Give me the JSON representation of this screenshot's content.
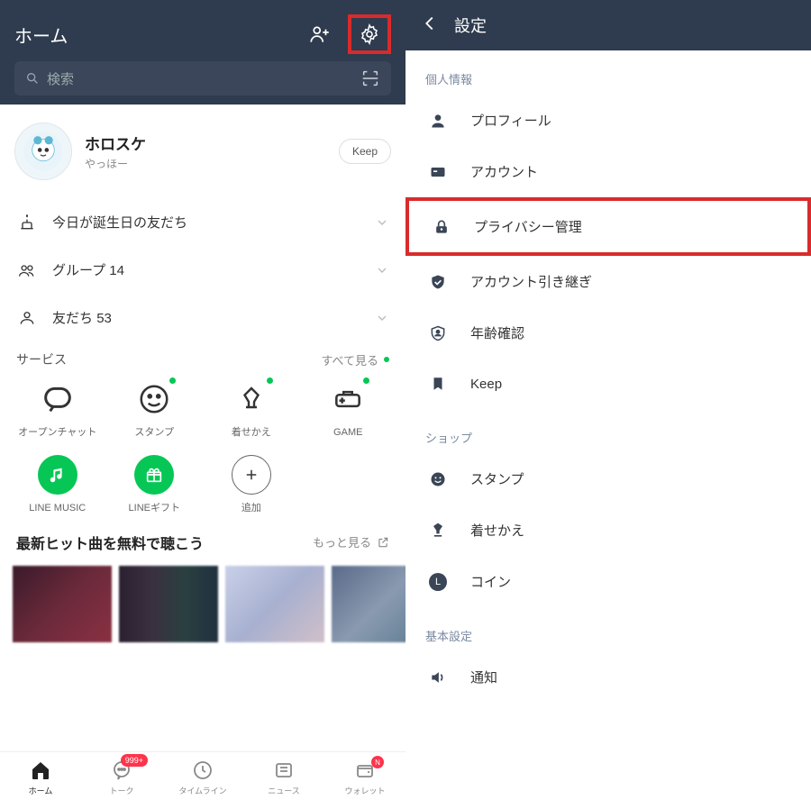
{
  "left": {
    "header": {
      "title": "ホーム"
    },
    "search": {
      "placeholder": "検索"
    },
    "profile": {
      "name": "ホロスケ",
      "status": "やっほー",
      "keep_label": "Keep"
    },
    "rows": {
      "birthday": "今日が誕生日の友だち",
      "groups_label": "グループ",
      "groups_count": "14",
      "friends_label": "友だち",
      "friends_count": "53"
    },
    "services": {
      "title": "サービス",
      "see_all": "すべて見る",
      "items": [
        {
          "label": "オープンチャット"
        },
        {
          "label": "スタンプ"
        },
        {
          "label": "着せかえ"
        },
        {
          "label": "GAME"
        },
        {
          "label": "LINE MUSIC"
        },
        {
          "label": "LINEギフト"
        },
        {
          "label": "追加"
        }
      ]
    },
    "music": {
      "title": "最新ヒット曲を無料で聴こう",
      "more": "もっと見る"
    },
    "tabs": [
      {
        "label": "ホーム"
      },
      {
        "label": "トーク",
        "badge": "999+"
      },
      {
        "label": "タイムライン"
      },
      {
        "label": "ニュース"
      },
      {
        "label": "ウォレット",
        "badge": "N"
      }
    ]
  },
  "right": {
    "title": "設定",
    "sections": {
      "personal": {
        "label": "個人情報",
        "items": [
          {
            "label": "プロフィール"
          },
          {
            "label": "アカウント"
          },
          {
            "label": "プライバシー管理"
          },
          {
            "label": "アカウント引き継ぎ"
          },
          {
            "label": "年齢確認"
          },
          {
            "label": "Keep"
          }
        ]
      },
      "shop": {
        "label": "ショップ",
        "items": [
          {
            "label": "スタンプ"
          },
          {
            "label": "着せかえ"
          },
          {
            "label": "コイン"
          }
        ]
      },
      "basic": {
        "label": "基本設定",
        "items": [
          {
            "label": "通知"
          }
        ]
      }
    }
  }
}
